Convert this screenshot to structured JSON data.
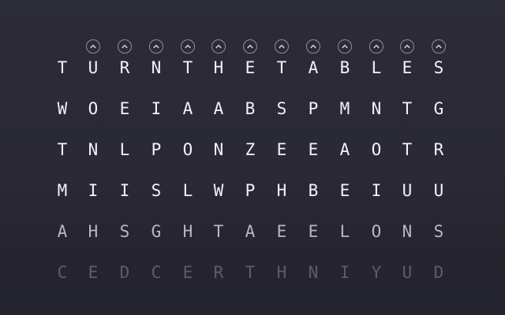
{
  "board": {
    "arrow_icon": "chevron-up-circle-icon",
    "columns": 12,
    "rows": [
      [
        "T",
        "U",
        "R",
        "N",
        "T",
        "H",
        "E",
        "T",
        "A",
        "B",
        "L",
        "E",
        "S"
      ],
      [
        "W",
        "O",
        "E",
        "I",
        "A",
        "A",
        "B",
        "S",
        "P",
        "M",
        "N",
        "T",
        "G"
      ],
      [
        "T",
        "N",
        "L",
        "P",
        "O",
        "N",
        "Z",
        "E",
        "E",
        "A",
        "O",
        "T",
        "R"
      ],
      [
        "M",
        "I",
        "I",
        "S",
        "L",
        "W",
        "P",
        "H",
        "B",
        "E",
        "I",
        "U",
        "U"
      ],
      [
        "A",
        "H",
        "S",
        "G",
        "H",
        "T",
        "A",
        "E",
        "E",
        "L",
        "O",
        "N",
        "S"
      ],
      [
        "C",
        "E",
        "D",
        "C",
        "E",
        "R",
        "T",
        "H",
        "N",
        "I",
        "Y",
        "U",
        "D"
      ]
    ]
  },
  "colors": {
    "background": "#2a2935",
    "letter_active": "#f2f2f6",
    "letter_fading": "#b8b7c1",
    "letter_faded": "#5d5c68",
    "arrow_stroke": "#8e8d99"
  }
}
